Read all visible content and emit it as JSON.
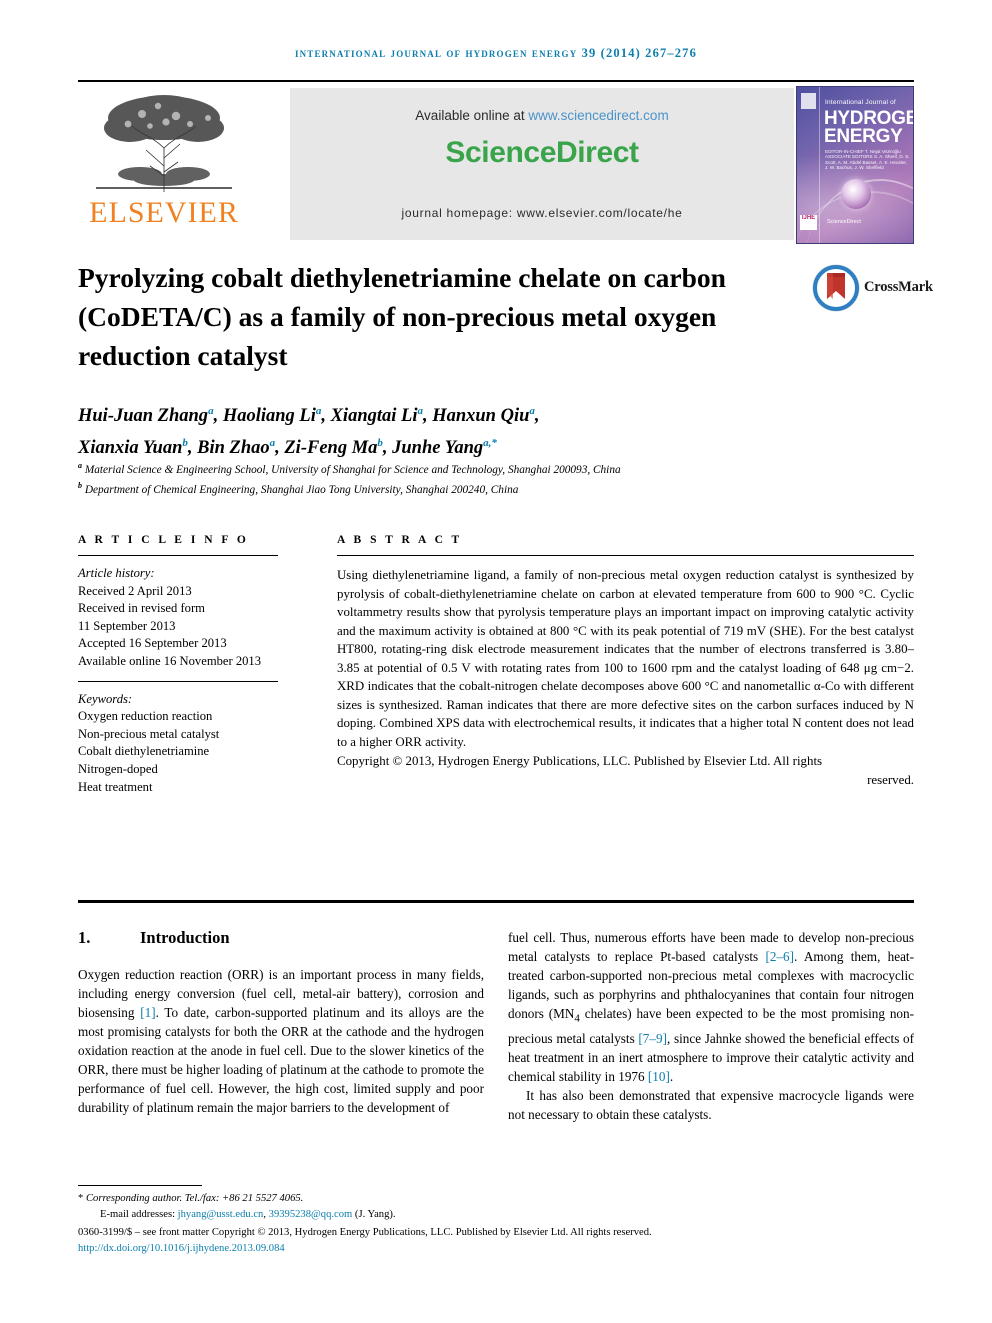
{
  "running_head": "international journal of hydrogen energy 39 (2014) 267–276",
  "masthead": {
    "publisher_name": "ELSEVIER",
    "available_text": "Available online at ",
    "available_url": "www.sciencedirect.com",
    "sciencedirect_logo": "ScienceDirect",
    "journal_homepage": "journal homepage: www.elsevier.com/locate/he",
    "cover": {
      "top_line": "International Journal of",
      "title_line1": "HYDROGEN",
      "title_line2": "ENERGY",
      "meta": "EDITOR-IN-CHIEF  T. Nejat Veziroğlu    ASSOCIATE EDITORS  S. A. Sherif, D. S. Scott, A. M. Abdel Basset, A. E. Heusler, J. W. Bachus, J. W. Sheffield",
      "science_direct": "ScienceDirect",
      "badge": "IJHE"
    }
  },
  "article": {
    "title": "Pyrolyzing cobalt diethylenetriamine chelate on carbon (CoDETA/C) as a family of non-precious metal oxygen reduction catalyst",
    "crossmark_label": "CrossMark",
    "authors": [
      {
        "name": "Hui-Juan Zhang",
        "mark": "a",
        "sep": ", "
      },
      {
        "name": "Haoliang Li",
        "mark": "a",
        "sep": ", "
      },
      {
        "name": "Xiangtai Li",
        "mark": "a",
        "sep": ", "
      },
      {
        "name": "Hanxun Qiu",
        "mark": "a",
        "sep": ","
      },
      {
        "name": "Xianxia Yuan",
        "mark": "b",
        "sep": ", "
      },
      {
        "name": "Bin Zhao",
        "mark": "a",
        "sep": ", "
      },
      {
        "name": "Zi-Feng Ma",
        "mark": "b",
        "sep": ", "
      },
      {
        "name": "Junhe Yang",
        "mark": "a,*",
        "sep": ""
      }
    ],
    "affiliations": [
      {
        "mark": "a",
        "text": "Material Science & Engineering School, University of Shanghai for Science and Technology, Shanghai 200093, China"
      },
      {
        "mark": "b",
        "text": "Department of Chemical Engineering, Shanghai Jiao Tong University, Shanghai 200240, China"
      }
    ]
  },
  "article_info": {
    "heading": "A R T I C L E  I N F O",
    "history_label": "Article history:",
    "history": [
      "Received 2 April 2013",
      "Received in revised form",
      "11 September 2013",
      "Accepted 16 September 2013",
      "Available online 16 November 2013"
    ],
    "keywords_label": "Keywords:",
    "keywords": [
      "Oxygen reduction reaction",
      "Non-precious metal catalyst",
      "Cobalt diethylenetriamine",
      "Nitrogen-doped",
      "Heat treatment"
    ]
  },
  "abstract": {
    "heading": "A B S T R A C T",
    "body": "Using diethylenetriamine ligand, a family of non-precious metal oxygen reduction catalyst is synthesized by pyrolysis of cobalt-diethylenetriamine chelate on carbon at elevated temperature from 600 to 900 °C. Cyclic voltammetry results show that pyrolysis temperature plays an important impact on improving catalytic activity and the maximum activity is obtained at 800 °C with its peak potential of 719 mV (SHE). For the best catalyst HT800, rotating-ring disk electrode measurement indicates that the number of electrons transferred is 3.80–3.85 at potential of 0.5 V with rotating rates from 100 to 1600 rpm and the catalyst loading of 648 μg cm−2. XRD indicates that the cobalt-nitrogen chelate decomposes above 600 °C and nanometallic α-Co with different sizes is synthesized. Raman indicates that there are more defective sites on the carbon surfaces induced by N doping. Combined XPS data with electrochemical results, it indicates that a higher total N content does not lead to a higher ORR activity.",
    "copyright_main": "Copyright © 2013, Hydrogen Energy Publications, LLC. Published by Elsevier Ltd. All rights",
    "copyright_tail": "reserved."
  },
  "introduction": {
    "number": "1.",
    "heading": "Introduction",
    "left_column": "Oxygen reduction reaction (ORR) is an important process in many fields, including energy conversion (fuel cell, metal-air battery), corrosion and biosensing [1]. To date, carbon-supported platinum and its alloys are the most promising catalysts for both the ORR at the cathode and the hydrogen oxidation reaction at the anode in fuel cell. Due to the slower kinetics of the ORR, there must be higher loading of platinum at the cathode to promote the performance of fuel cell. However, the high cost, limited supply and poor durability of platinum remain the major barriers to the development of",
    "left_citation": "[1]",
    "right_paragraph_1": "fuel cell. Thus, numerous efforts have been made to develop non-precious metal catalysts to replace Pt-based catalysts [2–6]. Among them, heat-treated carbon-supported non-precious metal complexes with macrocyclic ligands, such as porphyrins and phthalocyanines that contain four nitrogen donors (MN4 chelates) have been expected to be the most promising non-precious metal catalysts [7–9], since Jahnke showed the beneficial effects of heat treatment in an inert atmosphere to improve their catalytic activity and chemical stability in 1976 [10].",
    "right_paragraph_2": "It has also been demonstrated that expensive macrocycle ligands were not necessary to obtain these catalysts.",
    "citations": [
      "[2–6]",
      "[7–9]",
      "[10]"
    ]
  },
  "footer": {
    "corresponding": "Corresponding author. Tel./fax: +86 21 5527 4065.",
    "email_label": "E-mail addresses:",
    "email_1": "jhyang@usst.edu.cn",
    "email_2": "39395238@qq.com",
    "email_attrib": "(J. Yang).",
    "issn_line": "0360-3199/$ – see front matter Copyright © 2013, Hydrogen Energy Publications, LLC. Published by Elsevier Ltd. All rights reserved.",
    "doi": "http://dx.doi.org/10.1016/j.ijhydene.2013.09.084"
  },
  "colors": {
    "link_blue": "#0b7ead",
    "elsevier_orange": "#f08020",
    "sciencedirect_green": "#3aa44b",
    "banner_gray": "#e7e7e7"
  }
}
